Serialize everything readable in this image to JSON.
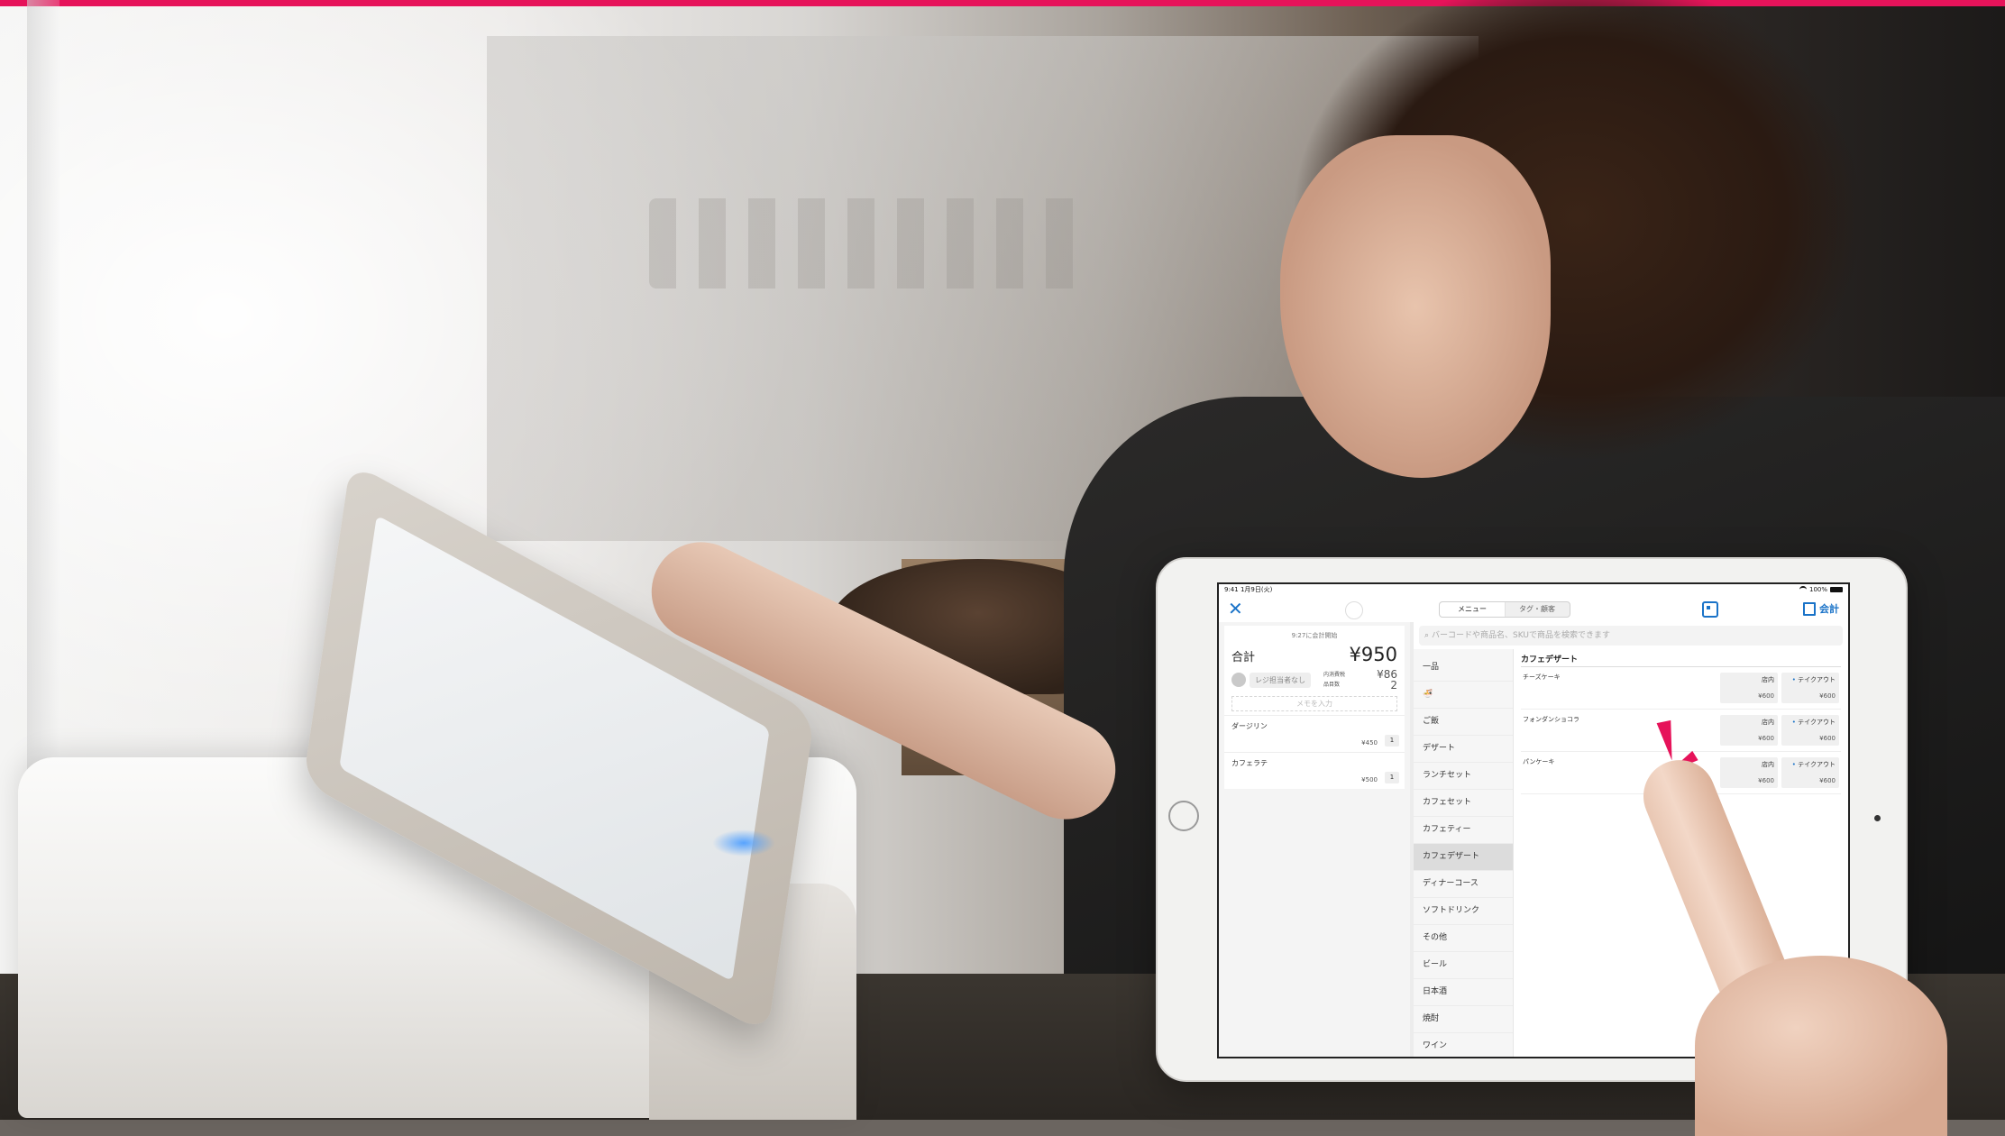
{
  "brand": {
    "accent_color": "#e6135a"
  },
  "ipad_app": {
    "status_bar": {
      "time": "9:41",
      "date": "1月9日(火)",
      "battery": "100%"
    },
    "nav": {
      "close_icon": "close-icon",
      "tabs": [
        {
          "label": "メニュー",
          "active": true
        },
        {
          "label": "タグ・顧客",
          "active": false
        }
      ],
      "scan_icon": "barcode-scan-icon",
      "checkout_label": "会計"
    },
    "order": {
      "started_at": "9:27に会計開始",
      "total_label": "合計",
      "total_value": "¥950",
      "staff_placeholder": "レジ担当者なし",
      "tax_label": "内消費税",
      "tax_value": "¥86",
      "items_count_label": "品目数",
      "items_count_value": "2",
      "memo_placeholder": "メモを入力",
      "line_items": [
        {
          "name": "ダージリン",
          "price": "¥450",
          "qty": "1"
        },
        {
          "name": "カフェラテ",
          "price": "¥500",
          "qty": "1"
        }
      ]
    },
    "search": {
      "placeholder": "バーコードや商品名、SKUで商品を検索できます"
    },
    "categories": [
      {
        "label": "一品",
        "selected": false
      },
      {
        "label": "🍜",
        "selected": false
      },
      {
        "label": "ご飯",
        "selected": false
      },
      {
        "label": "デザート",
        "selected": false
      },
      {
        "label": "ランチセット",
        "selected": false
      },
      {
        "label": "カフェセット",
        "selected": false
      },
      {
        "label": "カフェティー",
        "selected": false
      },
      {
        "label": "カフェデザート",
        "selected": true
      },
      {
        "label": "ディナーコース",
        "selected": false
      },
      {
        "label": "ソフトドリンク",
        "selected": false
      },
      {
        "label": "その他",
        "selected": false
      },
      {
        "label": "ビール",
        "selected": false
      },
      {
        "label": "日本酒",
        "selected": false
      },
      {
        "label": "焼酎",
        "selected": false
      },
      {
        "label": "ワイン",
        "selected": false
      }
    ],
    "products": {
      "header": "カフェデザート",
      "items": [
        {
          "name": "チーズケーキ",
          "variants": [
            {
              "label": "店内",
              "price": "¥600"
            },
            {
              "label": "テイクアウト",
              "price": "¥600"
            }
          ]
        },
        {
          "name": "フォンダンショコラ",
          "variants": [
            {
              "label": "店内",
              "price": "¥600"
            },
            {
              "label": "テイクアウト",
              "price": "¥600"
            }
          ]
        },
        {
          "name": "パンケーキ",
          "variants": [
            {
              "label": "店内",
              "price": "¥600"
            },
            {
              "label": "テイクアウト",
              "price": "¥600"
            }
          ]
        }
      ]
    }
  }
}
